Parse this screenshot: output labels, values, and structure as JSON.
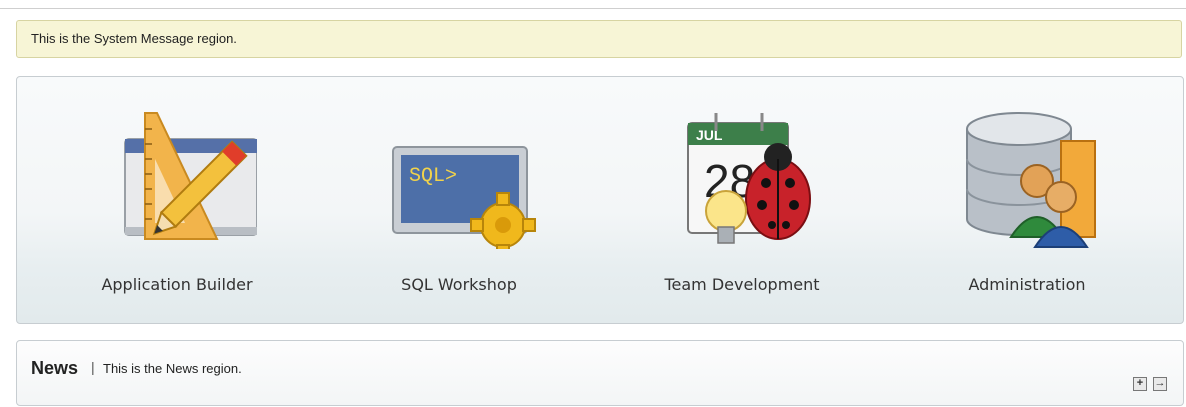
{
  "system_message": {
    "text": "This is the System Message region."
  },
  "apps": [
    {
      "label": "Application Builder",
      "icon": "application-builder-icon"
    },
    {
      "label": "SQL Workshop",
      "icon": "sql-workshop-icon",
      "icon_text": "SQL>"
    },
    {
      "label": "Team Development",
      "icon": "team-development-icon",
      "calendar_month": "JUL",
      "calendar_day": "28"
    },
    {
      "label": "Administration",
      "icon": "administration-icon"
    }
  ],
  "news": {
    "title": "News",
    "separator": "|",
    "text": "This is the News region.",
    "controls": [
      {
        "name": "expand",
        "glyph": "+"
      },
      {
        "name": "goto",
        "glyph": "→"
      }
    ]
  },
  "colors": {
    "system_message_bg": "#f7f5d6",
    "sql_screen": "#4d6fa8",
    "sql_text": "#f2d34a",
    "gear": "#f0b81c",
    "bug_red": "#c8222a"
  }
}
